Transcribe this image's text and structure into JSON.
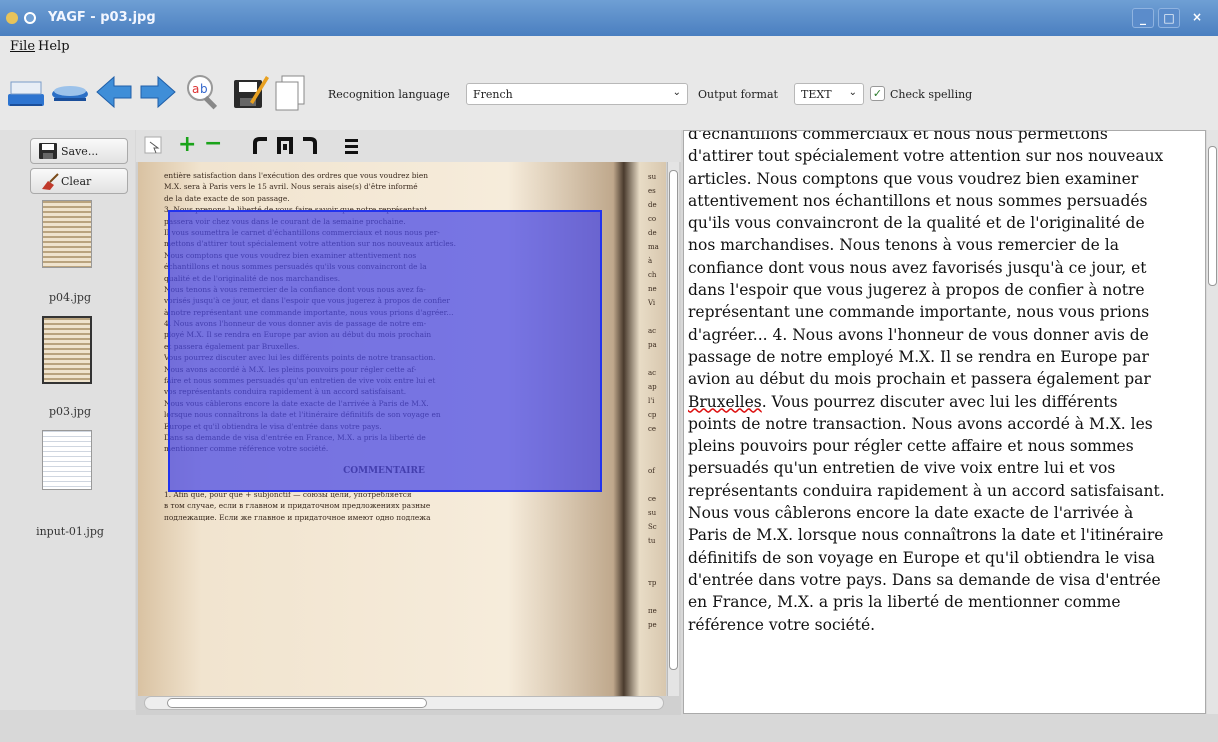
{
  "window": {
    "title": "YAGF - p03.jpg",
    "controls": [
      "_",
      "□",
      "×"
    ]
  },
  "menu": [
    {
      "label": "File"
    },
    {
      "label": "Help"
    }
  ],
  "toolbar": {
    "recognition_language_label": "Recognition language",
    "recognition_language_value": "French",
    "output_format_label": "Output format",
    "output_format_value": "TEXT",
    "check_spelling_label": "Check spelling",
    "check_spelling_checked": true
  },
  "sidebar": {
    "save_label": "Save...",
    "clear_label": "Clear",
    "thumbnails": [
      {
        "caption": "p04.jpg"
      },
      {
        "caption": "p03.jpg"
      },
      {
        "caption": "input-01.jpg"
      }
    ]
  },
  "viewer": {
    "tools": [
      "select-icon",
      "zoom-in-icon",
      "zoom-out-icon",
      "rotate-left-icon",
      "rotate-180-icon",
      "rotate-right-icon",
      "deskew-icon"
    ],
    "page_lines": [
      "entière satisfaction dans l'exécution des ordres que vous voudrez bien",
      "M.X. sera à Paris vers le 15 avril. Nous serais aise(s) d'être informé",
      "de la date exacte de son passage.",
      "3. Nous prenons la liberté de vous faire savoir que notre représentant",
      "passera voir chez vous dans le courant de la semaine prochaine.",
      "Il vous soumettra le carnet d'échantillons commerciaux et nous nous per-",
      "mettons d'attirer tout spécialement votre attention sur nos nouveaux articles.",
      "Nous comptons que vous voudrez bien examiner attentivement nos",
      "échantillons et nous sommes persuadés qu'ils vous convaincront de la",
      "qualité et de l'originalité de nos marchandises.",
      "Nous tenons à vous remercier de la confiance dont vous nous avez fa-",
      "vorisés jusqu'à ce jour, et dans l'espoir que vous jugerez à propos de confier",
      "à notre représentant une commande importante, nous vous prions d'agréer...",
      "4. Nous avons l'honneur de vous donner avis de passage de notre em-",
      "ployé M.X. Il se rendra en Europe par avion au début du mois prochain",
      "et passera également par Bruxelles.",
      "Vous pourrez discuter avec lui les différents points de notre transaction.",
      "Nous avons accordé à M.X. les pleins pouvoirs pour régler cette af-",
      "faire et nous sommes persuadés qu'un entretien de vive voix entre lui et",
      "vos représentants conduira rapidement à un accord satisfaisant.",
      "Nous vous câblerons encore la date exacte de l'arrivée à Paris de M.X.",
      "lorsque nous connaîtrons la date et l'itinéraire définitifs de son voyage en",
      "Europe et qu'il obtiendra le visa d'entrée dans votre pays.",
      "Dans sa demande de visa d'entrée en France, M.X. a pris la liberté de",
      "mentionner comme référence votre société.",
      "",
      "COMMENTAIRE",
      "",
      "1. Afin que, pour que + subjonctif — союзы цели, употребляется",
      "в том случае, если в главном и придаточном предложениях разные",
      "подлежащие. Если же главное и придаточное имеют одно подлежа"
    ],
    "side_letters": [
      "su",
      "es",
      "de",
      "co",
      "de",
      "ma",
      "à",
      "ch",
      "ne",
      "Vi",
      "",
      "ac",
      "pa",
      "",
      "ac",
      "ap",
      "l'i",
      "cp",
      "ce",
      "",
      "",
      "of",
      "",
      "ce",
      "su",
      "Sc",
      "tu",
      "",
      "",
      "тр",
      "",
      "пе",
      "ре"
    ]
  },
  "ocr_text": [
    "d'échantillons commerciaux et nous nous permettons",
    "d'attirer tout spécialement votre attention sur nos nouveaux",
    "articles. Nous comptons que vous voudrez bien examiner",
    "attentivement nos échantillons et nous sommes persuadés",
    "qu'ils vous convaincront de la qualité et de l'originalité de",
    "nos marchandises. Nous tenons à vous remercier de la",
    "confiance dont vous nous avez favorisés jusqu'à ce jour, et",
    "dans l'espoir que vous jugerez à propos de confier à notre",
    "représentant une commande importante, nous vous prions",
    "d'agréer... 4. Nous avons l'honneur de vous donner avis de",
    "passage de notre employé M.X. Il se rendra en Europe par",
    "avion au début du mois prochain et passera également par",
    "Bruxelles. Vous pourrez discuter avec lui les différents",
    "points de notre transaction. Nous avons accordé à M.X. les",
    "pleins pouvoirs pour régler cette affaire et nous sommes",
    "persuadés qu'un entretien de vive voix entre lui et vos",
    "représentants conduira rapidement à un accord satisfaisant.",
    "Nous vous câblerons encore la date exacte de l'arrivée à",
    "Paris de M.X. lorsque nous connaîtrons la date et l'itinéraire",
    "définitifs de son voyage en Europe et qu'il obtiendra le visa",
    "d'entrée dans votre pays. Dans sa demande de visa d'entrée",
    "en France, M.X. a pris la liberté de mentionner comme",
    "référence votre société."
  ],
  "misspelled_word": "Bruxelles",
  "colors": {
    "titlebar": "#4a7fc0",
    "selection": "#4646e6",
    "add_icon": "#1aa31a",
    "remove_icon": "#1aa31a",
    "arrow_icon": "#3f8ed8"
  }
}
